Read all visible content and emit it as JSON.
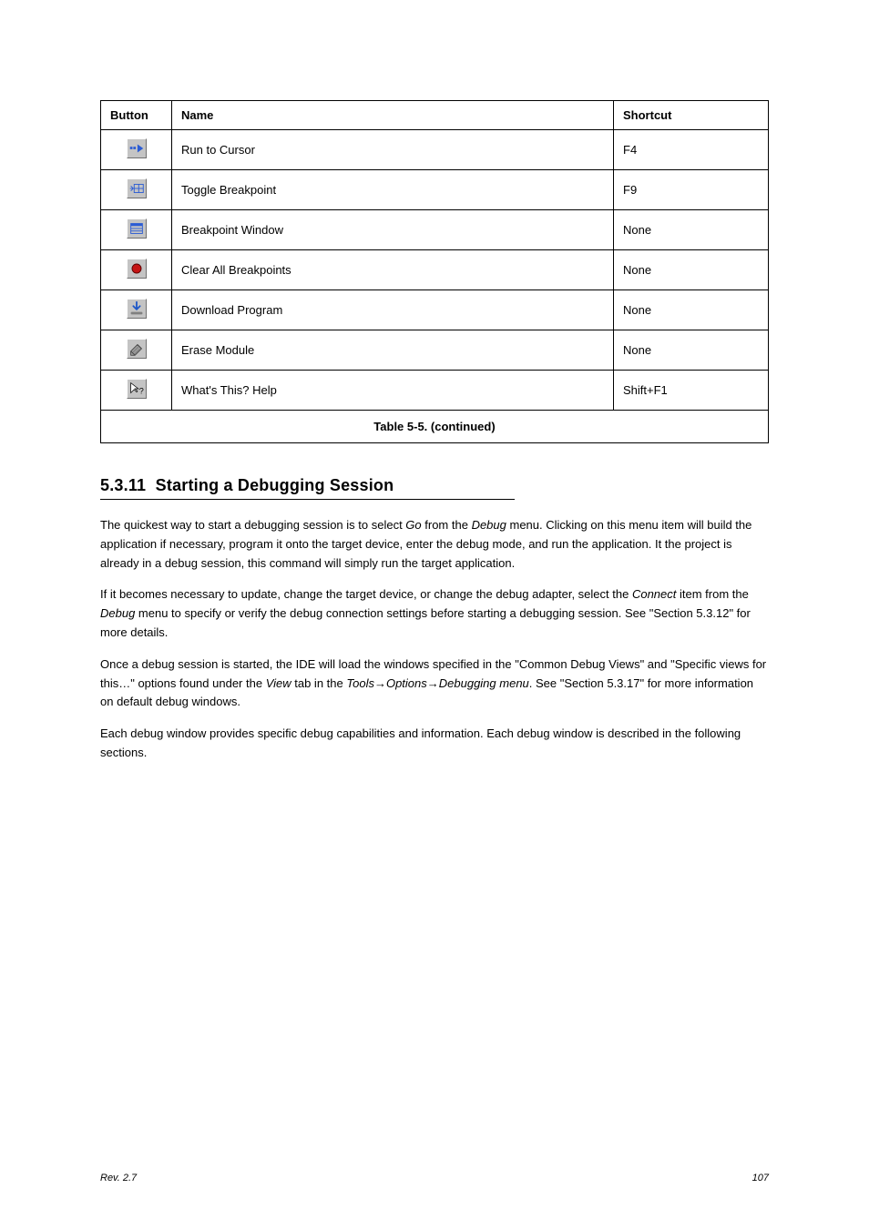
{
  "table": {
    "headers": [
      "Button",
      "Name",
      "Shortcut"
    ],
    "rows": [
      {
        "icon": "run-to-cursor-icon",
        "name": "Run to Cursor",
        "shortcut": "F4"
      },
      {
        "icon": "toggle-breakpoint-icon",
        "name": "Toggle Breakpoint",
        "shortcut": "F9"
      },
      {
        "icon": "breakpoint-window-icon",
        "name": "Breakpoint Window",
        "shortcut": "None"
      },
      {
        "icon": "clear-breakpoints-icon",
        "name": "Clear All Breakpoints",
        "shortcut": "None"
      },
      {
        "icon": "download-program-icon",
        "name": "Download Program",
        "shortcut": "None"
      },
      {
        "icon": "erase-module-icon",
        "name": "Erase Module",
        "shortcut": "None"
      },
      {
        "icon": "whats-this-icon",
        "name": "What's This? Help",
        "shortcut": "Shift+F1"
      }
    ],
    "caption": "Table 5-5. (continued)"
  },
  "section": {
    "number": "5.3.11",
    "title": "Starting a Debugging Session",
    "paragraphs": [
      "The quickest way to start a debugging session is to select ${debug_item} from the ${debug_menu} menu. Clicking on this menu item will build the application if necessary, program it onto the target device, enter the debug mode, and run the application. It the project is already in a debug session, this command will simply run the target application.",
      "If it becomes necessary to update, change the target device, or change the debug adapter, select the ${connect_item} item from the ${debug_menu} menu to specify or verify the debug connection settings before starting a debugging session. See \"Section 5.3.12\" for more details.",
      "Once a debug session is started, the IDE will load the windows specified in the \"Common Debug Views\" and \"Specific views for this…\" options found under the ${view_tab} tab in the ${tools_path}. See \"Section 5.3.17\" for more information on default debug windows.",
      "Each debug window provides specific debug capabilities and information. Each debug window is described in the following sections."
    ],
    "em": {
      "debug_item": "Go",
      "debug_menu": "Debug",
      "connect_item": "Connect",
      "view_tab": "View",
      "tools_path": "Tools→Options→Debugging menu"
    }
  },
  "footer": {
    "left": "Rev. 2.7",
    "right": "107"
  }
}
